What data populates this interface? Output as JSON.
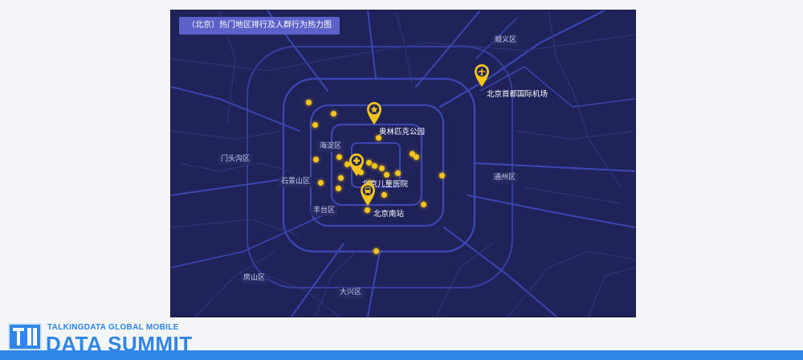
{
  "map": {
    "title": "（北京）热门地区排行及人群行为热力图",
    "districts": {
      "shunyi": "顺义区",
      "mentougou": "门头沟区",
      "haidian": "海淀区",
      "shijingshan": "石景山区",
      "fengtai": "丰台区",
      "tongzhou": "通州区",
      "fangshan": "房山区",
      "daxing": "大兴区"
    },
    "landmarks": {
      "airport": "北京首都国际机场",
      "olympic_park": "奥林匹克公园",
      "children_hospital": "北京儿童医院",
      "south_station": "北京南站"
    },
    "colors": {
      "background": "#20225a",
      "roads": "#3b46b0",
      "marker": "#f5c518",
      "title_bg": "#5b61c9"
    },
    "icons": {
      "airport": "airplane-icon",
      "olympic_park": "star-icon",
      "children_hospital": "medical-cross-icon",
      "south_station": "train-icon"
    }
  },
  "brand": {
    "top_text": "TALKINGDATA GLOBAL MOBILE",
    "main_text": "DATA SUMMIT",
    "accent": "#2f86e6"
  }
}
